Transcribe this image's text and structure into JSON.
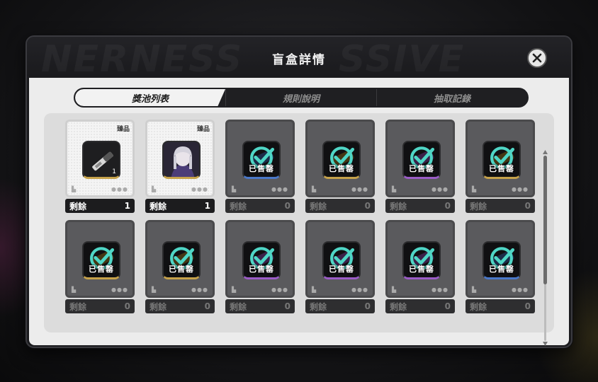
{
  "dialog": {
    "title": "盲盒詳情"
  },
  "header_decor": {
    "left": "NERNESS",
    "right": "SSIVE"
  },
  "tabs": [
    {
      "label": "獎池列表",
      "active": true
    },
    {
      "label": "規則說明",
      "active": false
    },
    {
      "label": "抽取記錄",
      "active": false
    }
  ],
  "remaining_label": "剩餘",
  "sold_label": "已售罄",
  "tag_label": "臻品",
  "items": [
    {
      "state": "available",
      "tag": "臻品",
      "thumb": "knife-item",
      "qty": "1",
      "remaining": "1",
      "frame": "gold"
    },
    {
      "state": "available",
      "tag": "臻品",
      "thumb": "character-portrait",
      "qty": "",
      "remaining": "1",
      "frame": "gold"
    },
    {
      "state": "sold",
      "thumb": "blue-item",
      "remaining": "0",
      "frame": "blue"
    },
    {
      "state": "sold",
      "thumb": "gold-item",
      "remaining": "0",
      "frame": "gold"
    },
    {
      "state": "sold",
      "thumb": "purple-item",
      "remaining": "0",
      "frame": "purple"
    },
    {
      "state": "sold",
      "thumb": "gold-item",
      "remaining": "0",
      "frame": "gold"
    },
    {
      "state": "sold",
      "thumb": "gold-item",
      "remaining": "0",
      "frame": "gold"
    },
    {
      "state": "sold",
      "thumb": "gold-item",
      "remaining": "0",
      "frame": "gold"
    },
    {
      "state": "sold",
      "thumb": "purple-item",
      "remaining": "0",
      "frame": "purple"
    },
    {
      "state": "sold",
      "thumb": "purple-item",
      "remaining": "0",
      "frame": "purple"
    },
    {
      "state": "sold",
      "thumb": "purple-item",
      "remaining": "0",
      "frame": "purple"
    },
    {
      "state": "sold",
      "thumb": "blue-item",
      "remaining": "0",
      "frame": "blue"
    }
  ],
  "colors": {
    "sold_check": "#4fd6c6",
    "gold_frame": "#c6a24a",
    "purple_frame": "#9b5cc7",
    "blue_frame": "#4a78c9"
  }
}
